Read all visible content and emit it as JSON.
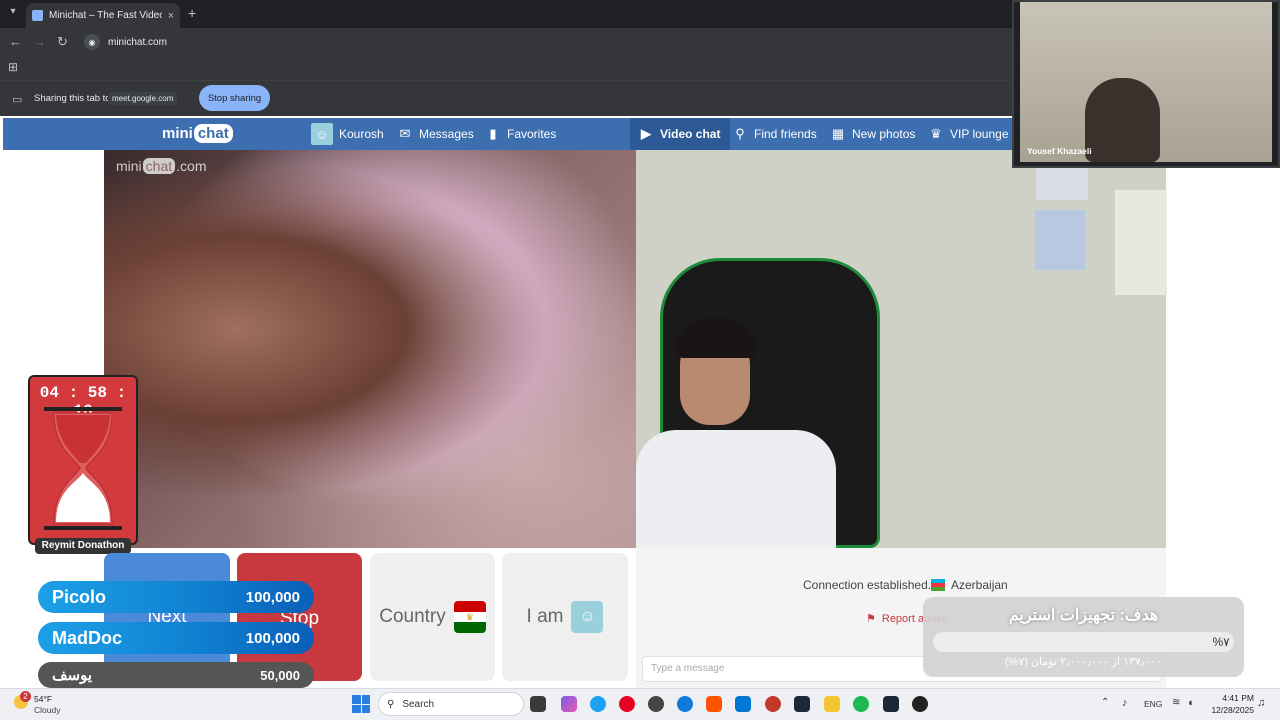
{
  "browser": {
    "tab_title": "Minichat – The Fast Video C",
    "tab_close": "×",
    "new_tab": "+",
    "url": "minichat.com",
    "share_text": "Sharing this tab to",
    "share_target": "meet.google.com",
    "stop_sharing": "Stop sharing"
  },
  "site": {
    "logo_mini": "mini",
    "logo_chat": "chat",
    "nav": {
      "user": "Kourosh",
      "messages": "Messages",
      "favorites": "Favorites",
      "video_chat": "Video chat",
      "find_friends": "Find friends",
      "new_photos": "New photos",
      "vip_lounge": "VIP lounge"
    },
    "watermark_mini": "mini",
    "watermark_chat": "chat",
    "watermark_com": ".com"
  },
  "meet": {
    "participant_name": "Yousef Khazaeli"
  },
  "timer": {
    "time": "04 : 58 : 16",
    "label": "Reymit Donathon"
  },
  "controls": {
    "next": "Next",
    "stop": "Stop",
    "country": "Country",
    "i_am": "I am"
  },
  "status": {
    "connection": "Connection established.",
    "country": "Azerbaijan",
    "report": "Report abuse",
    "message_placeholder": "Type a message"
  },
  "donations": [
    {
      "name": "Picolo",
      "amount": "100,000"
    },
    {
      "name": "MadDoc",
      "amount": "100,000"
    },
    {
      "name": "یوسف",
      "amount": "50,000"
    }
  ],
  "goal": {
    "title": "هدف: تجهیزات استریم",
    "percent_label": "%۷",
    "progress": 0.07,
    "subtitle": "۱۳۷٫۰۰۰ از ۲٫۰۰۰٫۰۰۰ تومان (۷%)"
  },
  "taskbar": {
    "weather_badge": "2",
    "temperature": "54°F",
    "weather": "Cloudy",
    "search": "Search",
    "language": "ENG",
    "time": "4:41 PM",
    "date": "12/28/2025"
  },
  "colors": {
    "site_nav": "#3d6eb0",
    "next_button": "#4a8ad8",
    "stop_button": "#c8393f",
    "timer_bg": "#d23a3e",
    "donation_bar": "#1da0e8"
  }
}
